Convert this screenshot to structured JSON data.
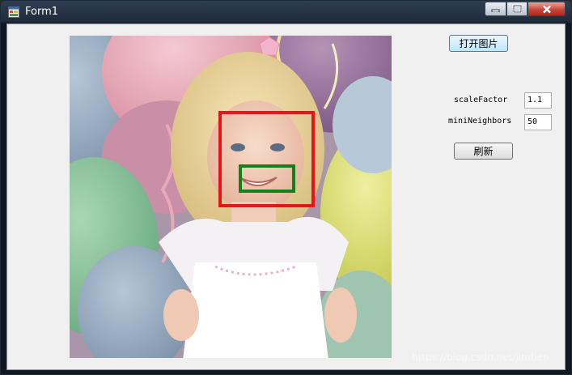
{
  "window": {
    "title": "Form1",
    "app_icon": "form-app-icon",
    "controls": {
      "minimize": "minimize-icon",
      "maximize": "maximize-icon",
      "close": "close-icon"
    }
  },
  "image": {
    "description_icon": "photo-image",
    "face_box_color": "#e8141b",
    "smile_box_color": "#11811a"
  },
  "buttons": {
    "open_image": "打开图片",
    "refresh": "刷新"
  },
  "params": {
    "scale_factor_label": "scaleFactor",
    "scale_factor_value": "1.1",
    "min_neighbors_label": "miniNeighbors",
    "min_neighbors_value": "50"
  },
  "watermark": "https://blog.csdn.net/jimtien"
}
